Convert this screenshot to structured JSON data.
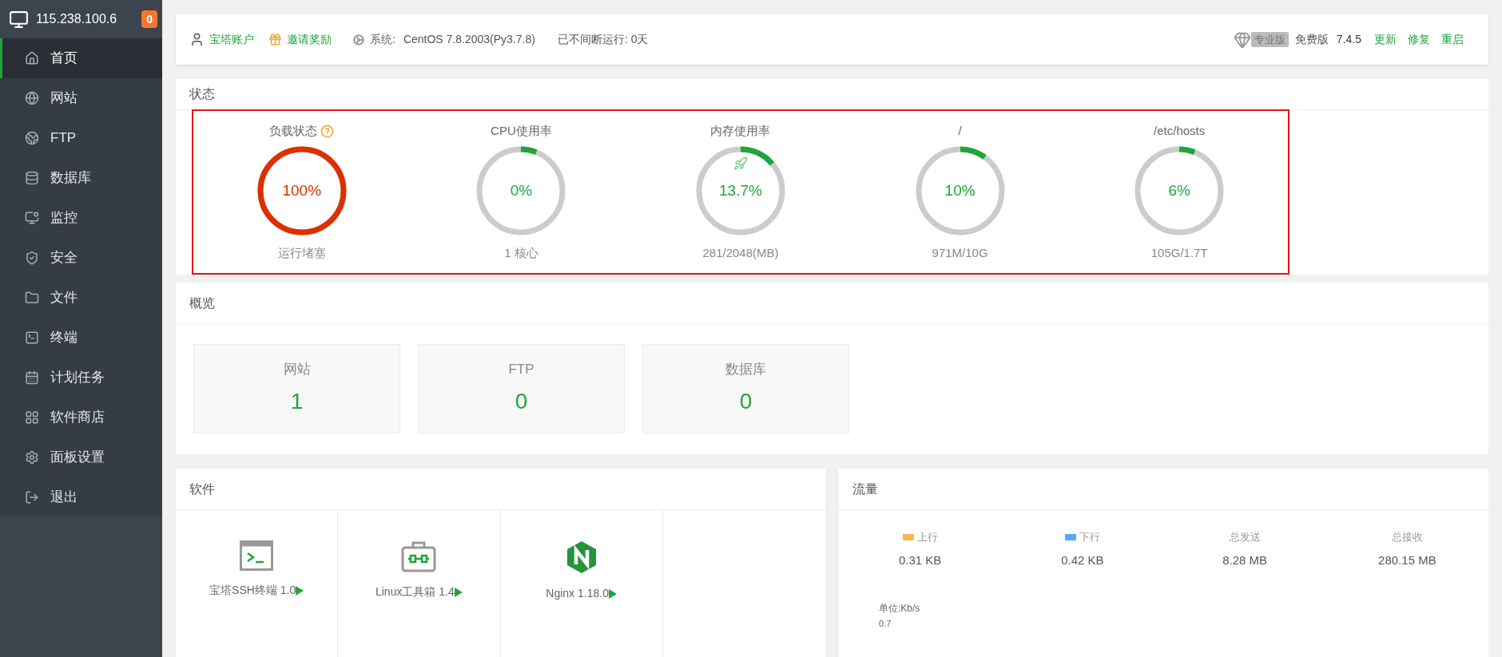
{
  "sidebar": {
    "host": "115.238.100.6",
    "badge": "0",
    "items": [
      {
        "label": "首页",
        "selected": true
      },
      {
        "label": "网站",
        "selected": false
      },
      {
        "label": "FTP",
        "selected": false
      },
      {
        "label": "数据库",
        "selected": false
      },
      {
        "label": "监控",
        "selected": false
      },
      {
        "label": "安全",
        "selected": false
      },
      {
        "label": "文件",
        "selected": false
      },
      {
        "label": "终端",
        "selected": false
      },
      {
        "label": "计划任务",
        "selected": false
      },
      {
        "label": "软件商店",
        "selected": false
      },
      {
        "label": "面板设置",
        "selected": false
      },
      {
        "label": "退出",
        "selected": false
      }
    ]
  },
  "top_bar": {
    "account_link": "宝塔账户",
    "invite_link": "邀请奖励",
    "system_label": "系统:",
    "system_value": "CentOS 7.8.2003(Py3.7.8)",
    "uptime": "已不间断运行: 0天",
    "pro_badge": "专业版",
    "edition": "免费版",
    "version": "7.4.5",
    "actions": [
      "更新",
      "修复",
      "重启"
    ]
  },
  "status": {
    "title": "状态",
    "gauges": [
      {
        "title": "负载状态",
        "help": true,
        "boost": false,
        "value": "100%",
        "caption": "运行堵塞",
        "level": 1,
        "color": "#dd2f00"
      },
      {
        "title": "CPU使用率",
        "help": false,
        "boost": false,
        "value": "0%",
        "caption": "1 核心",
        "level": 0.06,
        "color": "#20a53a"
      },
      {
        "title": "内存使用率",
        "help": false,
        "boost": true,
        "value": "13.7%",
        "caption": "281/2048(MB)",
        "level": 0.137,
        "color": "#20a53a"
      },
      {
        "title": "/",
        "help": false,
        "boost": false,
        "value": "10%",
        "caption": "971M/10G",
        "level": 0.1,
        "color": "#20a53a"
      },
      {
        "title": "/etc/hosts",
        "help": false,
        "boost": false,
        "value": "6%",
        "caption": "105G/1.7T",
        "level": 0.06,
        "color": "#20a53a"
      }
    ]
  },
  "overview": {
    "title": "概览",
    "cards": [
      {
        "label": "网站",
        "value": "1"
      },
      {
        "label": "FTP",
        "value": "0"
      },
      {
        "label": "数据库",
        "value": "0"
      }
    ]
  },
  "software": {
    "title": "软件",
    "items": [
      {
        "kind": "terminal",
        "name": "宝塔SSH终端 1.0"
      },
      {
        "kind": "toolbox",
        "name": "Linux工具箱 1.4"
      },
      {
        "kind": "nginx",
        "name": "Nginx 1.18.0"
      }
    ]
  },
  "traffic": {
    "title": "流量",
    "stats": [
      {
        "label": "上行",
        "value": "0.31 KB",
        "color": "#f8b551"
      },
      {
        "label": "下行",
        "value": "0.42 KB",
        "color": "#52a9ff"
      },
      {
        "label": "总发送",
        "value": "8.28 MB"
      },
      {
        "label": "总接收",
        "value": "280.15 MB"
      }
    ],
    "unit": "单位:Kb/s",
    "axis_tick": "0.7"
  }
}
